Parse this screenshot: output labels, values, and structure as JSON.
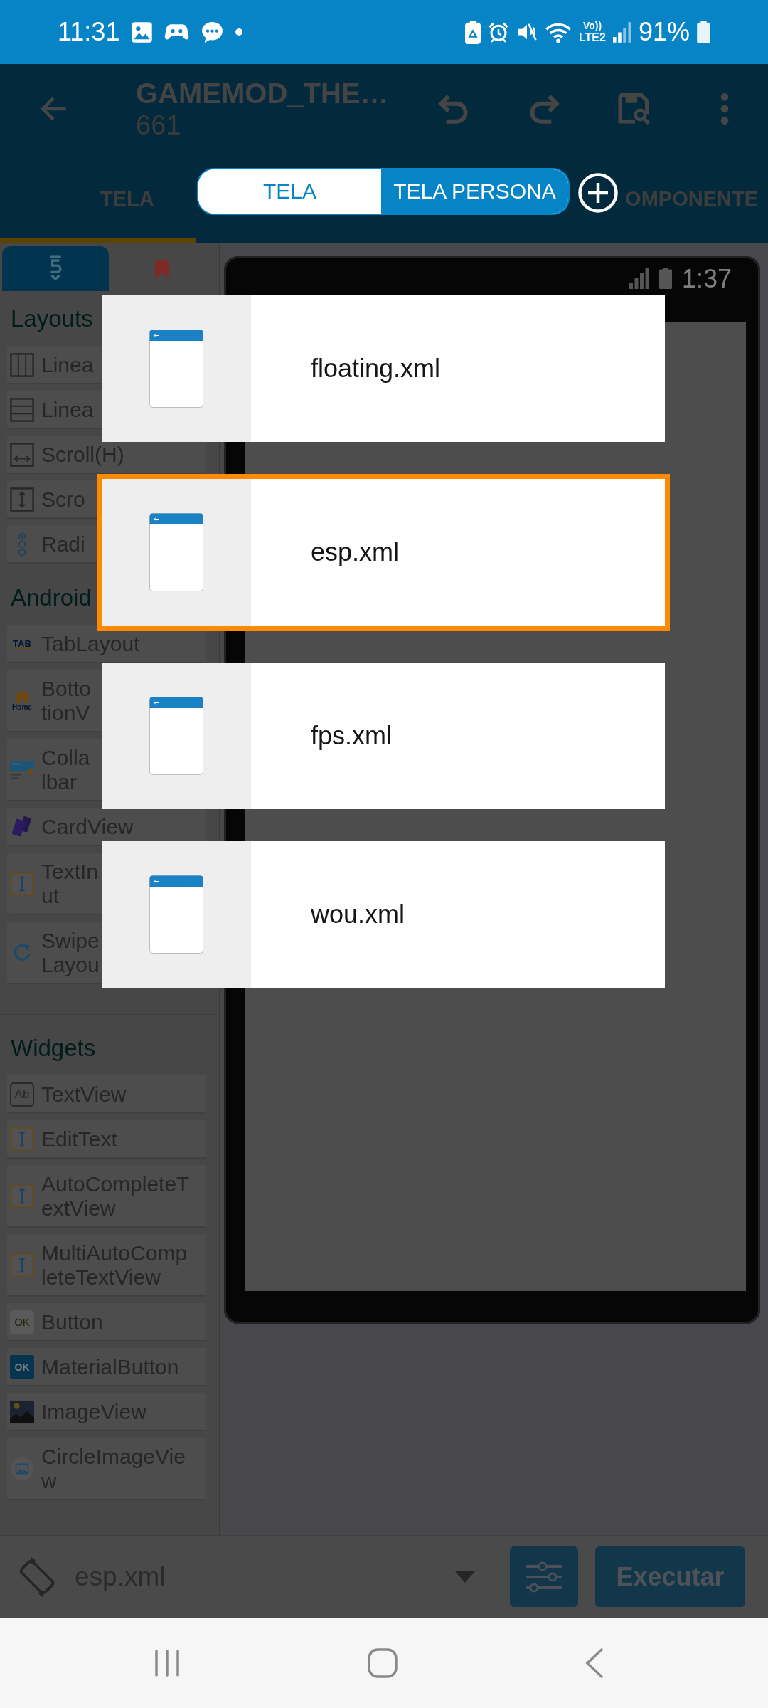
{
  "status_bar": {
    "time": "11:31",
    "volte": "Vo))",
    "network": "LTE2",
    "battery": "91%"
  },
  "app_bar": {
    "title": "GAMEMOD_THE…",
    "subtitle": "661"
  },
  "view_toggle": [
    {
      "label": "TELA",
      "selected": false
    },
    {
      "label": "TELA PERSONA",
      "selected": true
    }
  ],
  "tabs": [
    {
      "label": "TELA",
      "selected": true
    },
    {
      "label": "OMPONENTE",
      "selected": false
    }
  ],
  "palette": {
    "tabs": [
      {
        "kind": "components",
        "selected": true
      },
      {
        "kind": "bookmarks",
        "selected": false
      }
    ],
    "sections": [
      {
        "title": "Layouts",
        "items": [
          {
            "kind": "columns",
            "label": "Linea"
          },
          {
            "kind": "rows",
            "label": "Linea"
          },
          {
            "kind": "hscroll",
            "label": "Scroll(H)"
          },
          {
            "kind": "vscroll",
            "label": "Scro"
          },
          {
            "kind": "radio",
            "label": "Radi"
          }
        ]
      },
      {
        "title": "Android",
        "items": [
          {
            "kind": "tab",
            "icon_text": "TAB",
            "label": "TabLayout"
          },
          {
            "kind": "bottomnav",
            "icon_text": "Home",
            "label": "Botto\ntionV"
          },
          {
            "kind": "toolbar",
            "label": "Colla\nlbar"
          },
          {
            "kind": "card",
            "label": "CardView"
          },
          {
            "kind": "textinput",
            "label": "TextIn\nut"
          },
          {
            "kind": "refresh",
            "label": "Swipe\nLayou"
          }
        ]
      },
      {
        "title": "Widgets",
        "items": [
          {
            "kind": "textview",
            "icon_text": "Ab",
            "label": "TextView"
          },
          {
            "kind": "edittext",
            "label": "EditText"
          },
          {
            "kind": "edittext",
            "label": "AutoCompleteT\nextView"
          },
          {
            "kind": "edittext",
            "label": "MultiAutoComp\nleteTextView"
          },
          {
            "kind": "button",
            "icon_text": "OK",
            "label": "Button"
          },
          {
            "kind": "materialbutton",
            "icon_text": "OK",
            "label": "MaterialButton"
          },
          {
            "kind": "image",
            "label": "ImageView"
          },
          {
            "kind": "circleimage",
            "label": "CircleImageVie\nw"
          }
        ]
      }
    ]
  },
  "preview": {
    "time": "1:37"
  },
  "file_picker": {
    "files": [
      {
        "name": "floating.xml",
        "selected": false
      },
      {
        "name": "esp.xml",
        "selected": true
      },
      {
        "name": "fps.xml",
        "selected": false
      },
      {
        "name": "wou.xml",
        "selected": false
      }
    ]
  },
  "bottom_bar": {
    "file": "esp.xml",
    "run_button": "Executar"
  }
}
